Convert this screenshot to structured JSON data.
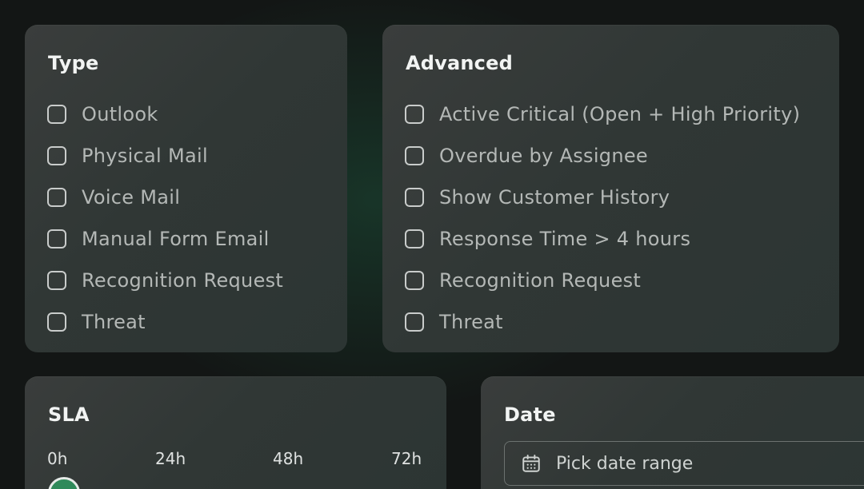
{
  "type_panel": {
    "title": "Type",
    "options": [
      {
        "label": "Outlook",
        "checked": false
      },
      {
        "label": "Physical Mail",
        "checked": false
      },
      {
        "label": "Voice Mail",
        "checked": false
      },
      {
        "label": "Manual Form Email",
        "checked": false
      },
      {
        "label": "Recognition Request",
        "checked": false
      },
      {
        "label": "Threat",
        "checked": false
      }
    ]
  },
  "advanced_panel": {
    "title": "Advanced",
    "options": [
      {
        "label": "Active Critical (Open + High Priority)",
        "checked": false
      },
      {
        "label": "Overdue by Assignee",
        "checked": false
      },
      {
        "label": "Show Customer History",
        "checked": false
      },
      {
        "label": "Response Time > 4 hours",
        "checked": false
      },
      {
        "label": "Recognition Request",
        "checked": false
      },
      {
        "label": "Threat",
        "checked": false
      }
    ]
  },
  "sla_panel": {
    "title": "SLA",
    "ticks": [
      "0h",
      "24h",
      "48h",
      "72h"
    ],
    "slider_accent": "#2f8a5a"
  },
  "date_panel": {
    "title": "Date",
    "placeholder": "Pick date range",
    "icon": "calendar-icon"
  },
  "colors": {
    "background": "#131615",
    "card": "#343938",
    "title_text": "#f2f4f3",
    "option_text": "#b4b8b6",
    "accent_green": "#2f8a5a"
  }
}
